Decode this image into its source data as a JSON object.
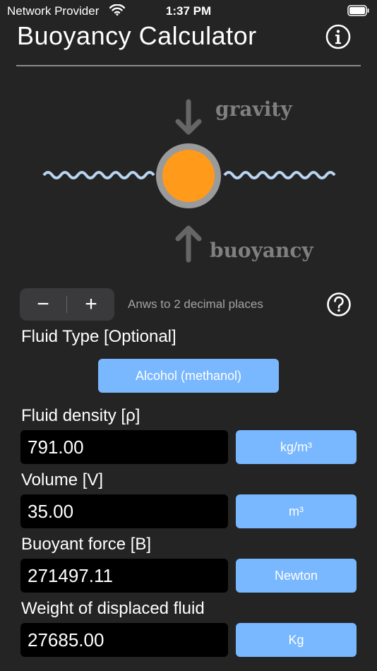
{
  "status_bar": {
    "carrier": "Network Provider",
    "time": "1:37 PM"
  },
  "header": {
    "title": "Buoyancy Calculator"
  },
  "diagram": {
    "gravity_label": "gravity",
    "buoyancy_label": "buoyancy",
    "ball_color": "#ff9a1a",
    "ring_color": "#9a9a9a",
    "wave_color": "#b8d4ef"
  },
  "stepper": {
    "minus": "−",
    "plus": "+",
    "hint": "Anws to 2 decimal places"
  },
  "fluid_type": {
    "label": "Fluid Type [Optional]",
    "value": "Alcohol (methanol)"
  },
  "fields": [
    {
      "label": "Fluid density [ρ]",
      "value": "791.00",
      "unit": "kg/m³"
    },
    {
      "label": "Volume [V]",
      "value": "35.00",
      "unit": "m³"
    },
    {
      "label": "Buoyant force [B]",
      "value": "271497.11",
      "unit": "Newton"
    },
    {
      "label": "Weight of displaced fluid",
      "value": "27685.00",
      "unit": "Kg"
    }
  ],
  "colors": {
    "background": "#242424",
    "accent": "#79b7ff",
    "field_bg": "#000000"
  }
}
